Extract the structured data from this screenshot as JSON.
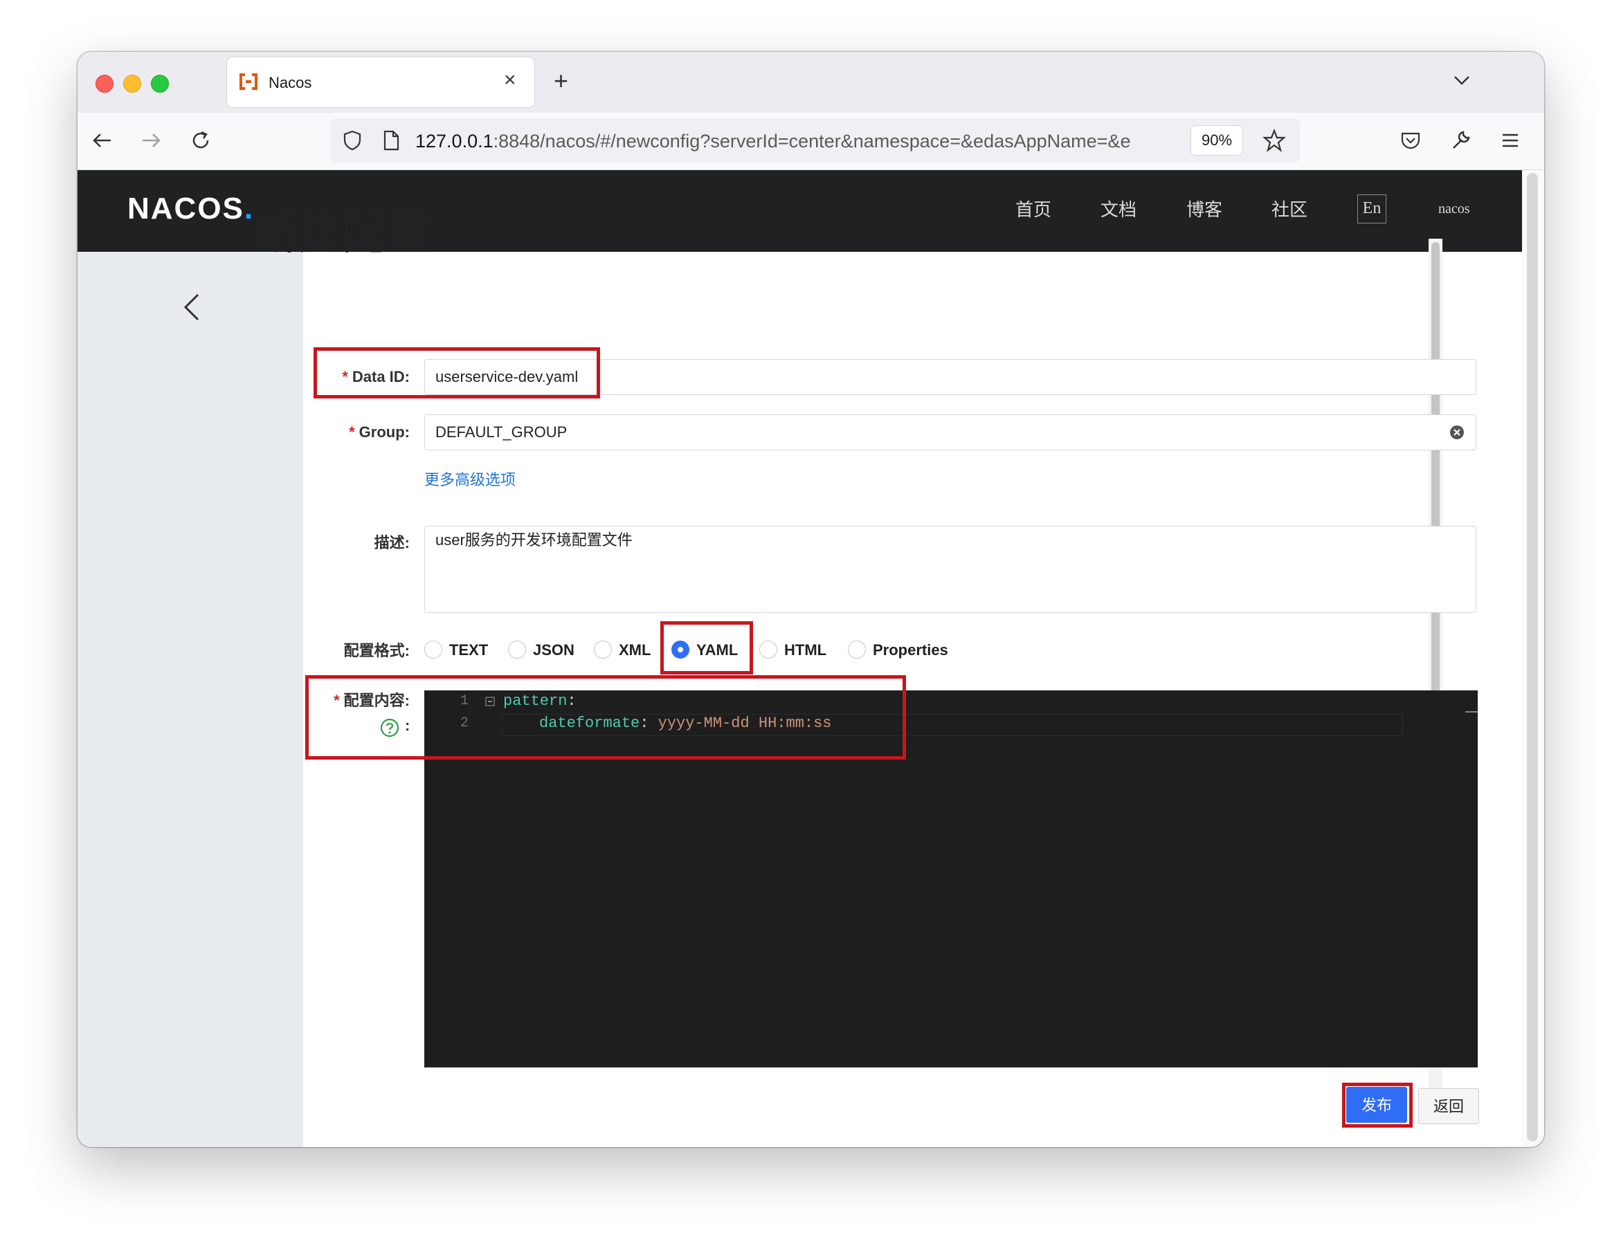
{
  "browser": {
    "tab_title": "Nacos",
    "url_host": "127.0.0.1",
    "url_rest": ":8848/nacos/#/newconfig?serverId=center&namespace=&edasAppName=&e",
    "zoom": "90%",
    "favicon_color": "#e1580f"
  },
  "header": {
    "logo_text": "NACOS",
    "logo_dot": ".",
    "menu": [
      "首页",
      "文档",
      "博客",
      "社区"
    ],
    "lang": "En",
    "user": "nacos"
  },
  "page": {
    "title": "新建配置"
  },
  "form": {
    "data_id_label": "Data ID:",
    "data_id_value": "userservice-dev.yaml",
    "group_label": "Group:",
    "group_value": "DEFAULT_GROUP",
    "more_options": "更多高级选项",
    "desc_label": "描述:",
    "desc_value": "user服务的开发环境配置文件",
    "format_label": "配置格式:",
    "formats": [
      "TEXT",
      "JSON",
      "XML",
      "YAML",
      "HTML",
      "Properties"
    ],
    "selected_format": "YAML",
    "content_label": "配置内容:",
    "help_colon": ":",
    "required_mark": "*"
  },
  "editor": {
    "line_numbers": [
      "1",
      "2"
    ],
    "line1_key": "pattern",
    "line1_punc": ":",
    "line2_key": "dateformate",
    "line2_punc": ": ",
    "line2_value": "yyyy-MM-dd HH:mm:ss"
  },
  "actions": {
    "publish": "发布",
    "back": "返回"
  },
  "colors": {
    "accent": "#2f6df6",
    "highlight": "#c8161d",
    "header_bg": "#1f2123"
  }
}
